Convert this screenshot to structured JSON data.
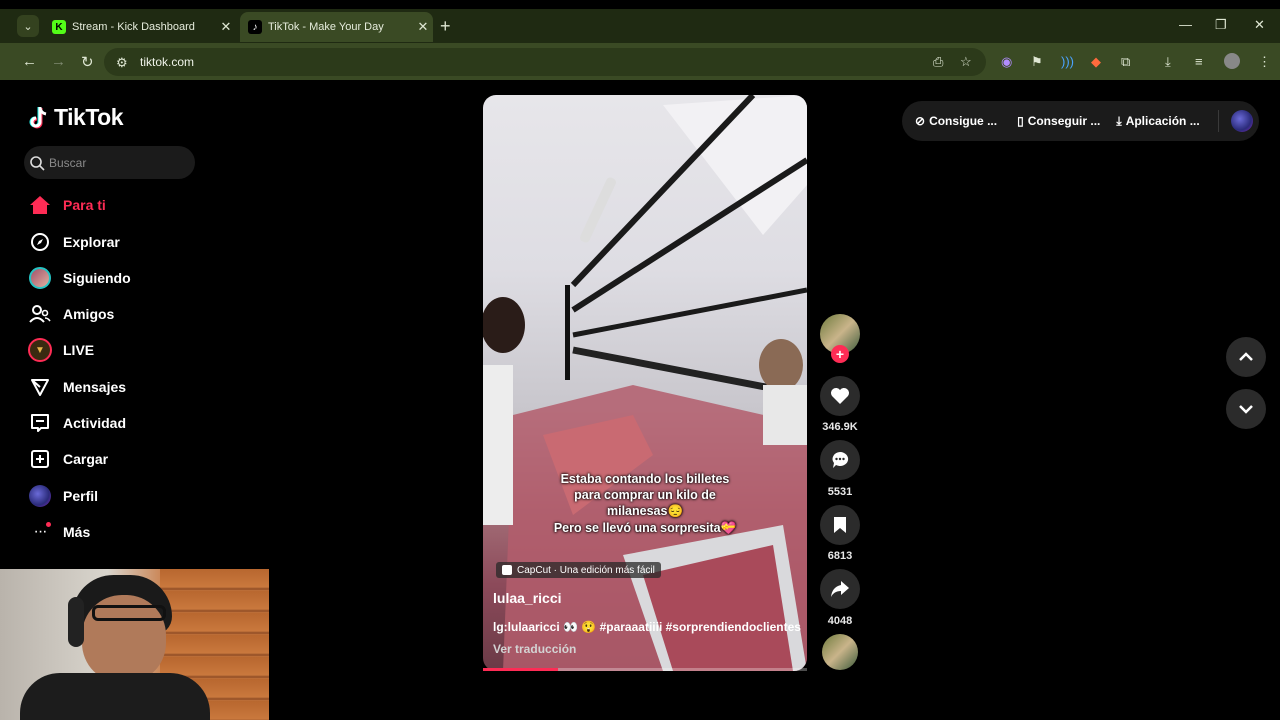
{
  "browser": {
    "tabs": [
      {
        "title": "Stream - Kick Dashboard",
        "active": false
      },
      {
        "title": "TikTok - Make Your Day",
        "active": true
      }
    ],
    "url": "tiktok.com"
  },
  "sidebar": {
    "logo": "TikTok",
    "search_placeholder": "Buscar",
    "items": [
      {
        "label": "Para ti",
        "icon": "home-icon",
        "active": true
      },
      {
        "label": "Explorar",
        "icon": "compass-icon"
      },
      {
        "label": "Siguiendo",
        "icon": "following-avatar-icon"
      },
      {
        "label": "Amigos",
        "icon": "friends-icon"
      },
      {
        "label": "LIVE",
        "icon": "live-icon"
      },
      {
        "label": "Mensajes",
        "icon": "send-icon"
      },
      {
        "label": "Actividad",
        "icon": "activity-icon"
      },
      {
        "label": "Cargar",
        "icon": "upload-icon"
      },
      {
        "label": "Perfil",
        "icon": "profile-icon"
      },
      {
        "label": "Más",
        "icon": "more-icon"
      }
    ]
  },
  "topbar": {
    "items": [
      "Consigue ...",
      "Conseguir ...",
      "Aplicación ..."
    ]
  },
  "video": {
    "caption_lines": [
      "Estaba contando los billetes",
      "para comprar un kilo de",
      "milanesas😔",
      "Pero se llevó una sorpresita💝"
    ],
    "capcut_label": "CapCut · Una edición más fácil",
    "author": "lulaa_ricci",
    "description": "lg:lulaaricci 👀 😲 #paraaatiiii #sorprendiendoclientes",
    "translate": "Ver traducción",
    "progress": 0.23
  },
  "actions": {
    "likes": "346.9K",
    "comments": "5531",
    "saves": "6813",
    "shares": "4048"
  },
  "colors": {
    "accent": "#fe2c55",
    "tab_bar": "#1f2a12",
    "toolbar": "#3a4a24"
  }
}
